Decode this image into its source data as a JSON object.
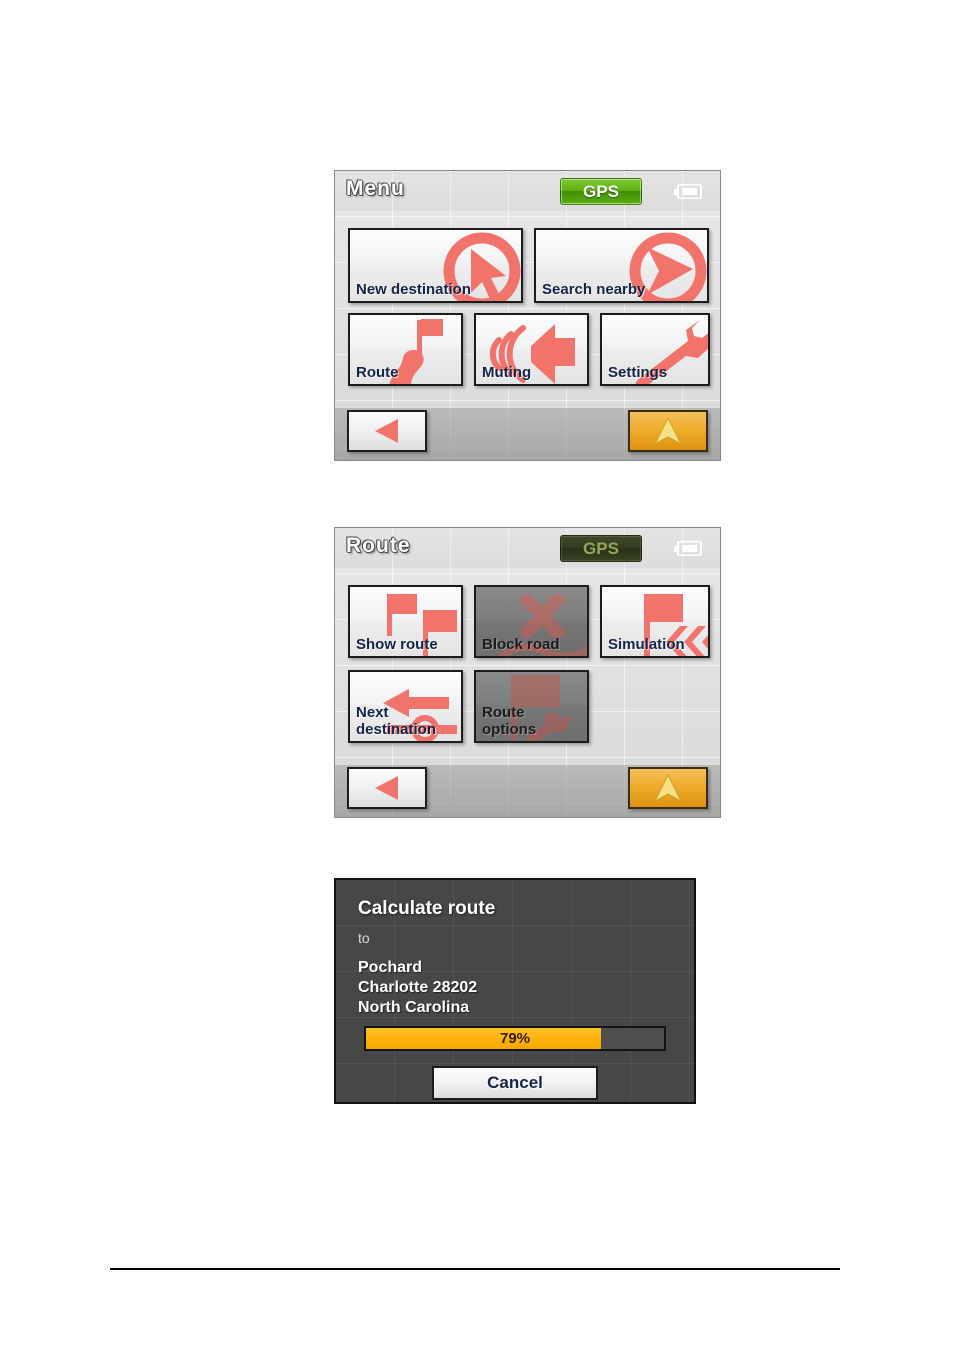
{
  "screens": [
    {
      "id": "menu-screen",
      "title": "Menu",
      "gps": {
        "label": "GPS",
        "state": "active"
      },
      "battery_icon": "battery-icon",
      "tiles": [
        {
          "label": "New destination",
          "icon": "cursor-arrow-in-circle-icon",
          "enabled": true
        },
        {
          "label": "Search nearby",
          "icon": "compass-needle-in-circle-icon",
          "enabled": true
        },
        {
          "label": "Route",
          "icon": "road-with-flag-icon",
          "enabled": true
        },
        {
          "label": "Muting",
          "icon": "speaker-sound-icon",
          "enabled": true
        },
        {
          "label": "Settings",
          "icon": "wrench-icon",
          "enabled": true
        }
      ],
      "back_icon": "back-triangle-icon",
      "nav_icon": "navigation-arrow-icon"
    },
    {
      "id": "route-screen",
      "title": "Route",
      "gps": {
        "label": "GPS",
        "state": "inactive"
      },
      "battery_icon": "battery-icon",
      "tiles": [
        {
          "label": "Show route",
          "icon": "two-flags-icon",
          "enabled": true
        },
        {
          "label": "Block road",
          "icon": "red-cross-on-road-icon",
          "enabled": false
        },
        {
          "label": "Simulation",
          "icon": "flag-with-chevrons-icon",
          "enabled": true
        },
        {
          "label": "Next\ndestination",
          "icon": "left-arrow-waypoint-icon",
          "enabled": true
        },
        {
          "label": "Route\noptions",
          "icon": "flag-with-wrench-icon",
          "enabled": false
        }
      ],
      "back_icon": "back-triangle-icon",
      "nav_icon": "navigation-arrow-icon"
    }
  ],
  "dialog": {
    "title": "Calculate route",
    "to_label": "to",
    "address_lines": [
      "Pochard",
      "Charlotte 28202",
      "North Carolina"
    ],
    "progress": {
      "percent": 79,
      "text": "79%"
    },
    "cancel_label": "Cancel"
  },
  "colors": {
    "accent_red": "#f2736a",
    "gps_active": "#5fb314",
    "gps_inactive": "#343d1f",
    "progress_orange": "#ffb20d",
    "nav_orange": "#eeaa2a",
    "dialog_bg": "#474745"
  }
}
